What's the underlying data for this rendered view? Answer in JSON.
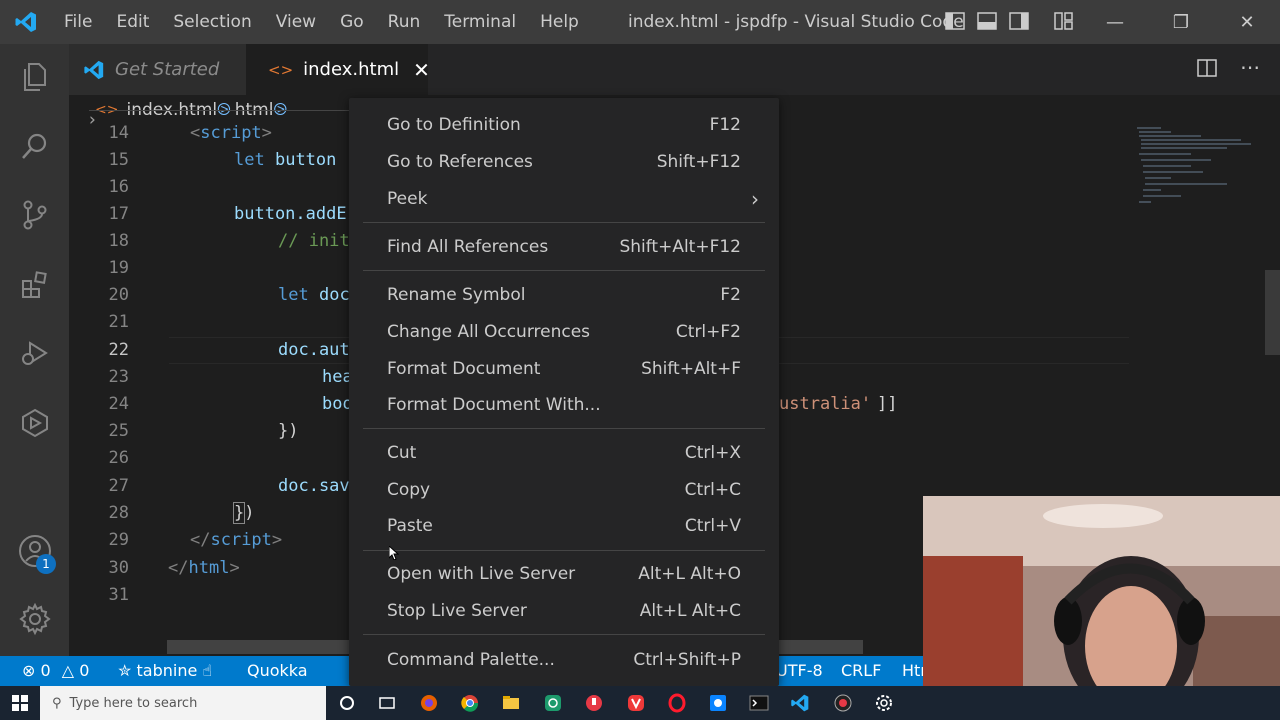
{
  "window": {
    "title": "index.html - jspdfp - Visual Studio Code",
    "menu": [
      "File",
      "Edit",
      "Selection",
      "View",
      "Go",
      "Run",
      "Terminal",
      "Help"
    ]
  },
  "tabs": [
    {
      "label": "Get Started"
    },
    {
      "label": "index.html"
    }
  ],
  "breadcrumb": [
    "index.html",
    "html"
  ],
  "activity": {
    "accounts_badge": "1"
  },
  "editor": {
    "lines": [
      {
        "n": "14"
      },
      {
        "n": "15"
      },
      {
        "n": "16"
      },
      {
        "n": "17"
      },
      {
        "n": "18"
      },
      {
        "n": "19"
      },
      {
        "n": "20"
      },
      {
        "n": "21"
      },
      {
        "n": "22"
      },
      {
        "n": "23"
      },
      {
        "n": "24"
      },
      {
        "n": "25"
      },
      {
        "n": "26"
      },
      {
        "n": "27"
      },
      {
        "n": "28"
      },
      {
        "n": "29"
      },
      {
        "n": "30"
      },
      {
        "n": "31"
      }
    ],
    "t": {
      "script_open": "script",
      "let": "let",
      "button": "button",
      "button_add": "button.addE",
      "comment": "// init",
      "doc": "doc",
      "doc_auto": "doc.aut",
      "hea": "hea",
      "boo": "boo",
      "ustralia": "ustralia'",
      "close_brackets": "]]",
      "close_paren": "})",
      "doc_save": "doc.sav",
      "brace": "}",
      "paren": ")",
      "script_close": "script",
      "html_close": "html"
    }
  },
  "context_menu": {
    "items": [
      {
        "label": "Go to Definition",
        "key": "F12"
      },
      {
        "label": "Go to References",
        "key": "Shift+F12"
      },
      {
        "label": "Peek",
        "key": ""
      },
      {
        "label": "Find All References",
        "key": "Shift+Alt+F12"
      },
      {
        "label": "Rename Symbol",
        "key": "F2"
      },
      {
        "label": "Change All Occurrences",
        "key": "Ctrl+F2"
      },
      {
        "label": "Format Document",
        "key": "Shift+Alt+F"
      },
      {
        "label": "Format Document With...",
        "key": ""
      },
      {
        "label": "Cut",
        "key": "Ctrl+X"
      },
      {
        "label": "Copy",
        "key": "Ctrl+C"
      },
      {
        "label": "Paste",
        "key": "Ctrl+V"
      },
      {
        "label": "Open with Live Server",
        "key": "Alt+L Alt+O"
      },
      {
        "label": "Stop Live Server",
        "key": "Alt+L Alt+C"
      },
      {
        "label": "Command Palette...",
        "key": "Ctrl+Shift+P"
      }
    ]
  },
  "status": {
    "errors": "0",
    "warnings": "0",
    "tabnine": "tabnine",
    "quokka": "Quokka",
    "encoding": "UTF-8",
    "eol": "CRLF",
    "lang": "Htı"
  },
  "taskbar": {
    "search_placeholder": "Type here to search"
  },
  "colors": {
    "accent": "#007acc",
    "titlebar": "#3c3c3c",
    "activitybar": "#333333",
    "editor": "#1e1e1e",
    "menu": "#252526"
  }
}
